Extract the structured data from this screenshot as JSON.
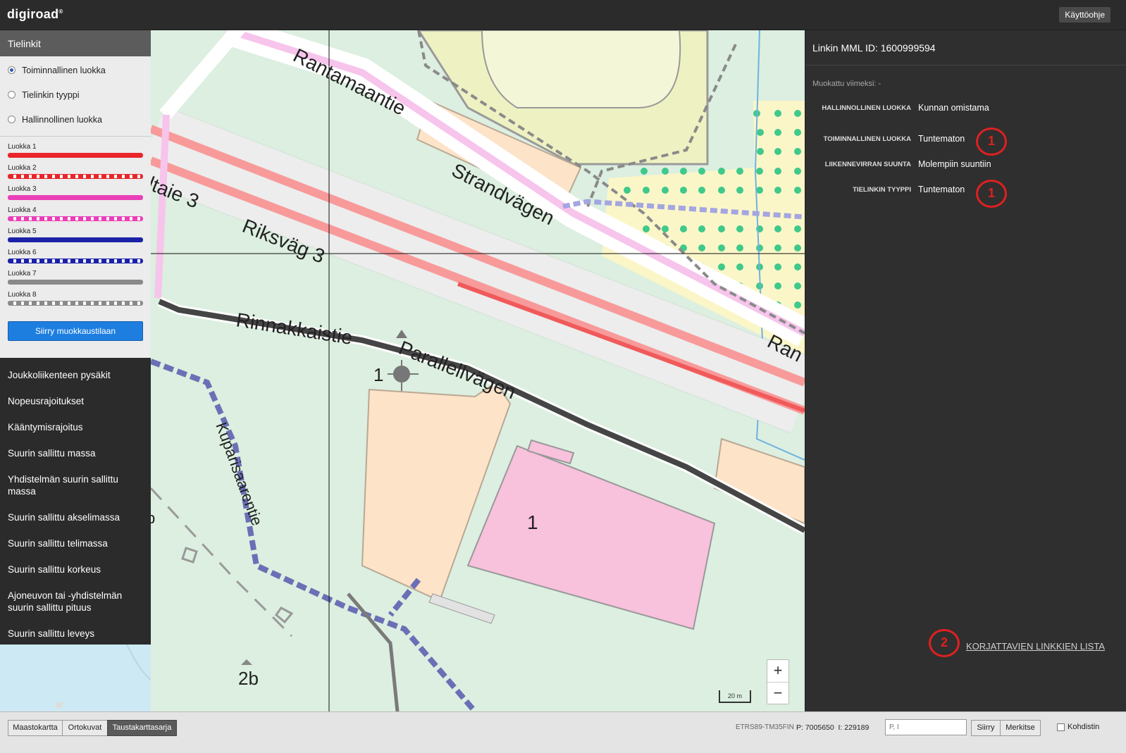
{
  "app": {
    "logo": "digiroad",
    "registered": "®",
    "help_label": "Käyttöohje"
  },
  "left_panel": {
    "header": "Tielinkit",
    "radios": [
      {
        "label": "Toiminnallinen luokka",
        "selected": true
      },
      {
        "label": "Tielinkin tyyppi",
        "selected": false
      },
      {
        "label": "Hallinnollinen luokka",
        "selected": false
      }
    ],
    "legend": [
      {
        "label": "Luokka 1",
        "color": "#e8262a",
        "dashed": false
      },
      {
        "label": "Luokka 2",
        "color": "#e8262a",
        "dashed": true
      },
      {
        "label": "Luokka 3",
        "color": "#ea3fb8",
        "dashed": false
      },
      {
        "label": "Luokka 4",
        "color": "#ea3fb8",
        "dashed": true
      },
      {
        "label": "Luokka 5",
        "color": "#1c22a8",
        "dashed": false
      },
      {
        "label": "Luokka 6",
        "color": "#1c22a8",
        "dashed": true
      },
      {
        "label": "Luokka 7",
        "color": "#8a8a8a",
        "dashed": false
      },
      {
        "label": "Luokka 8",
        "color": "#8a8a8a",
        "dashed": true
      }
    ],
    "edit_button": "Siirry muokkaustilaan",
    "layers": [
      "Joukkoliikenteen pysäkit",
      "Nopeusrajoitukset",
      "Kääntymisrajoitus",
      "Suurin sallittu massa",
      "Yhdistelmän suurin sallittu massa",
      "Suurin sallittu akselimassa",
      "Suurin sallittu telimassa",
      "Suurin sallittu korkeus",
      "Ajoneuvon tai -yhdistelmän suurin sallittu pituus",
      "Suurin sallittu leveys"
    ]
  },
  "map": {
    "labels": {
      "rantamaantie": "Rantamaantie",
      "strandvagen": "Strandvägen",
      "ran": "Ran",
      "altaie3": "ltaie 3",
      "riksvag3": "Riksväg 3",
      "rinnakkaistie": "Rinnakkaistie",
      "parallellvagen": "Parallellvägen",
      "kuparisaarentie": "Kuparisaarentie",
      "num1_left": "1",
      "num1_building": "1",
      "num2b": "2b",
      "edge_b": "b"
    },
    "zoom_in": "+",
    "zoom_out": "−",
    "scale": "20 m"
  },
  "right_panel": {
    "title": "Linkin MML ID: 1600999594",
    "modified": "Muokattu viimeksi: -",
    "attributes": [
      {
        "label": "HALLINNOLLINEN LUOKKA",
        "value": "Kunnan omistama"
      },
      {
        "label": "TOIMINNALLINEN LUOKKA",
        "value": "Tuntematon"
      },
      {
        "label": "LIIKENNEVIRRAN SUUNTA",
        "value": "Molempiin suuntiin"
      },
      {
        "label": "TIELINKIN TYYPPI",
        "value": "Tuntematon"
      }
    ],
    "markers": [
      "1",
      "1",
      "2"
    ],
    "fix_link": "KORJATTAVIEN LINKKIEN LISTA"
  },
  "bottom_bar": {
    "bg_buttons": [
      {
        "label": "Maastokartta",
        "active": false
      },
      {
        "label": "Ortokuvat",
        "active": false
      },
      {
        "label": "Taustakarttasarja",
        "active": true
      }
    ],
    "coord_system": "ETRS89-TM35FIN",
    "coords": "P: 7005650  I: 229189",
    "coord_placeholder": "P, I",
    "move_button": "Siirry",
    "mark_button": "Merkitse",
    "crosshair_label": "Kohdistin"
  }
}
